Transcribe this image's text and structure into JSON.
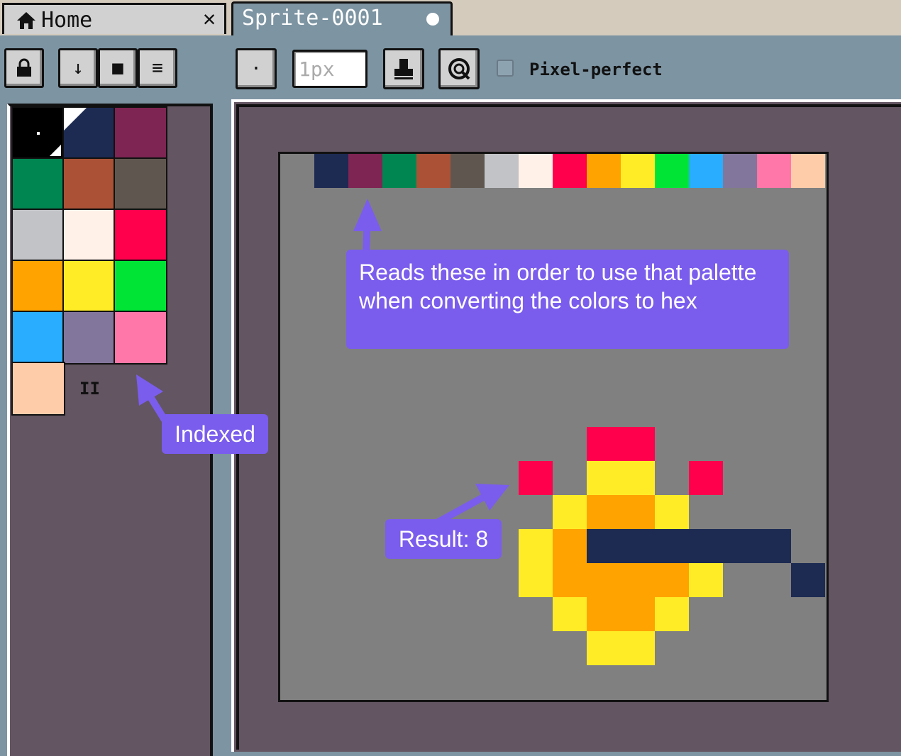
{
  "tabs": [
    {
      "label": "Home",
      "icon": "home-icon",
      "close": "✕"
    },
    {
      "label": "Sprite-0001",
      "modified_indicator": "●"
    }
  ],
  "toolbar": {
    "buttons": [
      {
        "name": "lock",
        "glyph": "🔒"
      },
      {
        "name": "down",
        "glyph": "↓"
      },
      {
        "name": "square",
        "glyph": "■"
      },
      {
        "name": "menu",
        "glyph": "≡"
      },
      {
        "name": "brush-type",
        "glyph": "·"
      }
    ],
    "brush_size_value": "1px",
    "pixel_perfect_label": "Pixel-perfect",
    "pixel_perfect_checked": false
  },
  "palette": {
    "colors": [
      "#000000",
      "#1d2b53",
      "#7e2553",
      "#008751",
      "#ab5236",
      "#5f574f",
      "#c2c3c7",
      "#fff1e8",
      "#ff004d",
      "#ffa300",
      "#ffec27",
      "#00e436",
      "#29adff",
      "#83769c",
      "#ff77a8",
      "#ffccaa"
    ],
    "pause_glyph": "II"
  },
  "sprite": {
    "background": "#808080",
    "palette_row": [
      "#1d2b53",
      "#7e2553",
      "#008751",
      "#ab5236",
      "#5f574f",
      "#c2c3c7",
      "#fff1e8",
      "#ff004d",
      "#ffa300",
      "#ffec27",
      "#00e436",
      "#29adff",
      "#83769c",
      "#ff77a8",
      "#ffccaa"
    ]
  },
  "annotations": {
    "palette_note": "Reads these in order to use that palette when converting the colors to hex",
    "indexed_note": "Indexed",
    "result_note": "Result: 8"
  }
}
